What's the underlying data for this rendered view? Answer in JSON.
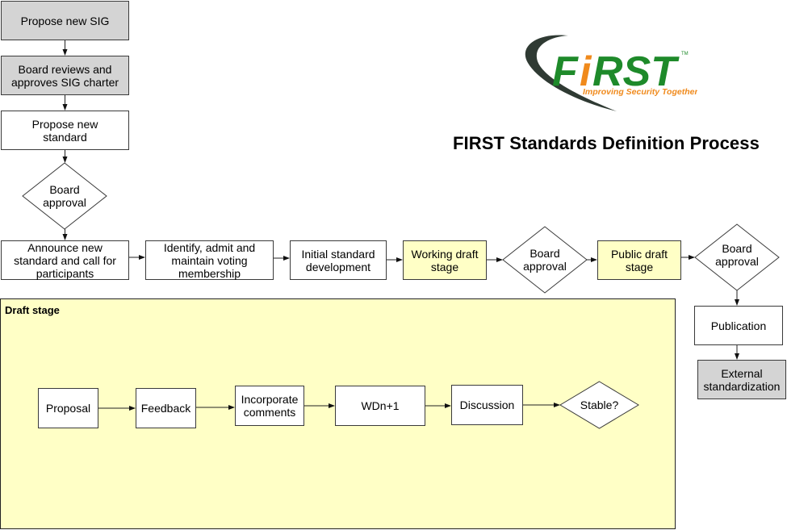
{
  "title": "FIRST Standards Definition Process",
  "logo": {
    "wordmark_prefix": "F",
    "wordmark_i": "i",
    "wordmark_suffix": "RST",
    "trademark": "TM",
    "tagline": "Improving Security Together",
    "colors": {
      "green": "#1e8a2a",
      "orange": "#f08a1c",
      "swoosh": "#2f3a33"
    }
  },
  "colors": {
    "gray_fill": "#d4d4d4",
    "yellow_fill": "#ffffc6",
    "white_fill": "#ffffff",
    "stroke": "#3a3a3a"
  },
  "main_flow": {
    "propose_sig": "Propose new SIG",
    "board_reviews": "Board reviews and\napproves SIG charter",
    "propose_standard": "Propose new\nstandard",
    "board_approval_1": "Board\napproval",
    "announce": "Announce new\nstandard and call for\nparticipants",
    "identify": "Identify, admit and\nmaintain voting\nmembership",
    "initial_dev": "Initial standard\ndevelopment",
    "working_draft": "Working draft\nstage",
    "board_approval_2": "Board\napproval",
    "public_draft": "Public draft\nstage",
    "board_approval_3": "Board\napproval",
    "publication": "Publication",
    "external": "External\nstandardization"
  },
  "draft_stage": {
    "title": "Draft stage",
    "steps": {
      "proposal": "Proposal",
      "feedback": "Feedback",
      "incorporate": "Incorporate\ncomments",
      "wdn1": "WDn+1",
      "discussion": "Discussion",
      "stable": "Stable?"
    }
  }
}
